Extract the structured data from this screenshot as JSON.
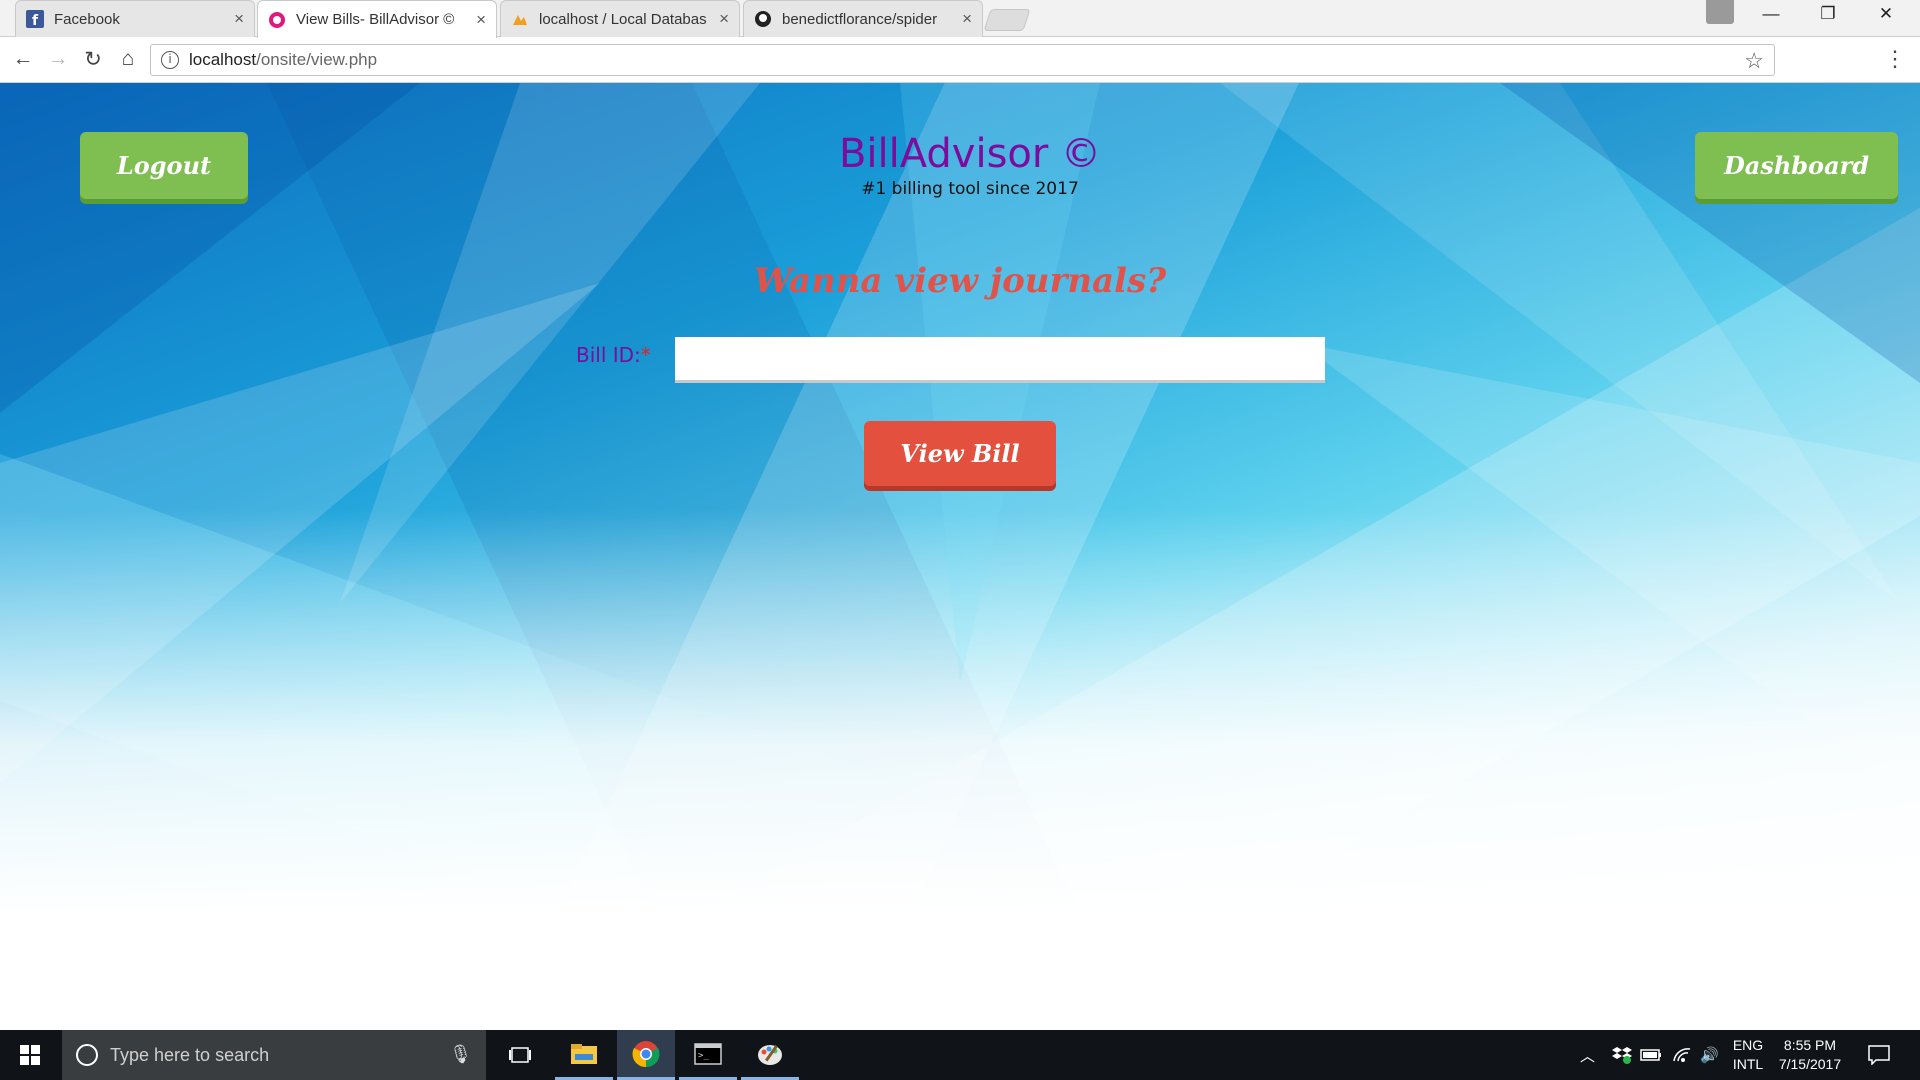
{
  "browser": {
    "tabs": [
      {
        "title": "Facebook",
        "icon": "facebook-icon"
      },
      {
        "title": "View Bills- BillAdvisor ©",
        "icon": "billadvisor-icon"
      },
      {
        "title": "localhost / Local Databas",
        "icon": "phpmyadmin-icon"
      },
      {
        "title": "benedictflorance/spider",
        "icon": "github-icon"
      }
    ],
    "close_glyph": "×",
    "url_host": "localhost",
    "url_path": "/onsite/view.php"
  },
  "page": {
    "logout_label": "Logout",
    "dashboard_label": "Dashboard",
    "brand_title": "BillAdvisor ©",
    "brand_tagline": "#1 billing tool since 2017",
    "subheading": "Wanna view journals?",
    "bill_label": "Bill ID:",
    "required_mark": "*",
    "bill_value": "",
    "view_button": "View Bill"
  },
  "taskbar": {
    "search_placeholder": "Type here to search",
    "lang_primary": "ENG",
    "lang_secondary": "INTL",
    "time": "8:55 PM",
    "date": "7/15/2017"
  }
}
